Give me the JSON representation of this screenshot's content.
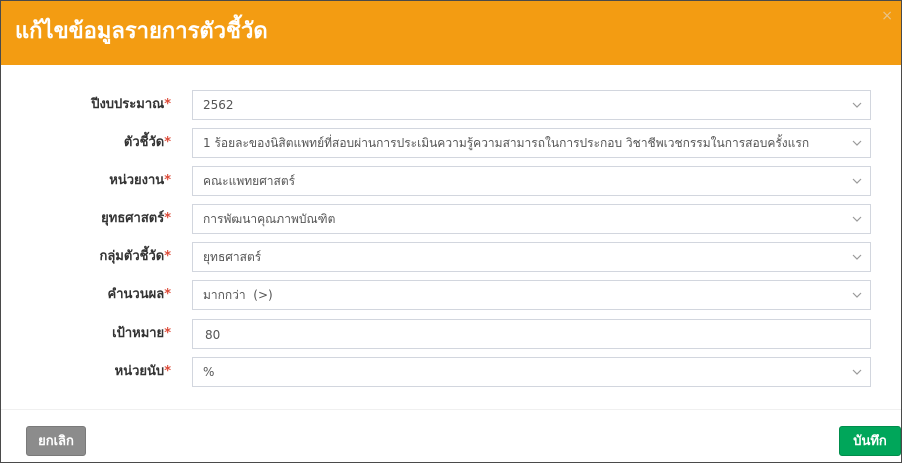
{
  "modal": {
    "title": "แก้ไขข้อมูลรายการตัวชี้วัด",
    "close_symbol": "×"
  },
  "form": {
    "required_marker": "*",
    "fields": [
      {
        "label": "ปีงบประมาณ",
        "value": "2562",
        "control": "select"
      },
      {
        "label": "ตัวชี้วัด",
        "value": "1 ร้อยละของนิสิตแพทย์ที่สอบผ่านการประเมินความรู้ความสามารถในการประกอบ วิชาชีพเวชกรรมในการสอบครั้งแรก",
        "control": "select"
      },
      {
        "label": "หน่วยงาน",
        "value": "คณะแพทยศาสตร์",
        "control": "select"
      },
      {
        "label": "ยุทธศาสตร์",
        "value": "การพัฒนาคุณภาพบัณฑิต",
        "control": "select"
      },
      {
        "label": "กลุ่มตัวชี้วัด",
        "value": "ยุทธศาสตร์",
        "control": "select"
      },
      {
        "label": "คำนวนผล",
        "value": "มากกว่า  (>)",
        "control": "select"
      },
      {
        "label": "เป้าหมาย",
        "value": "80",
        "control": "input"
      },
      {
        "label": "หน่วยนับ",
        "value": "%",
        "control": "select"
      }
    ]
  },
  "footer": {
    "cancel_label": "ยกเลิก",
    "save_label": "บันทึก"
  },
  "colors": {
    "header": "#f39c12",
    "required": "#dd4b39",
    "cancel_button": "#8c8c8c",
    "save_button": "#00a65a"
  },
  "icons": {
    "dropdown": "chevron-down-icon",
    "close": "close-icon"
  }
}
